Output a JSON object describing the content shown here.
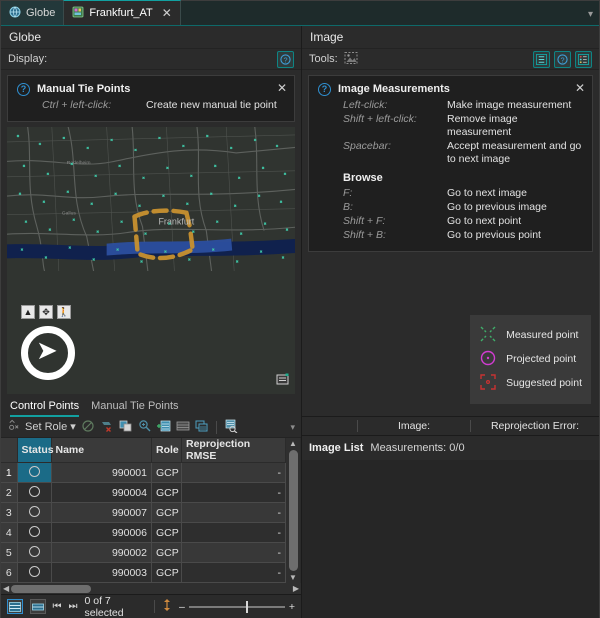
{
  "tabs": [
    {
      "label": "Globe",
      "icon": "globe-icon",
      "active": false,
      "closable": false
    },
    {
      "label": "Frankfurt_AT",
      "icon": "project-icon",
      "active": true,
      "closable": true
    }
  ],
  "tabbar": {
    "overflow_icon": "chevron-down-icon"
  },
  "globe_panel": {
    "title": "Globe",
    "display_label": "Display:",
    "help_icon": "question-circle-icon",
    "hint": {
      "icon": "question-circle-icon",
      "title": "Manual Tie Points",
      "close_icon": "close-icon",
      "rows": [
        {
          "key": "Ctrl + left-click:",
          "value": "Create new manual tie point"
        }
      ]
    },
    "map": {
      "place_label": "Frankfurt",
      "nav_buttons": [
        "home-icon",
        "pan-icon",
        "walk-icon"
      ],
      "compass_icon": "compass-needle-icon",
      "corner_icon": "layers-icon"
    }
  },
  "image_panel": {
    "title": "Image",
    "tools_label": "Tools:",
    "tools_icon": "image-measure-icon",
    "right_icons": [
      "list-detail-icon",
      "question-circle-icon",
      "list-bullet-icon"
    ],
    "hint": {
      "icon": "question-circle-icon",
      "title": "Image Measurements",
      "close_icon": "close-icon",
      "rows": [
        {
          "key": "Left-click:",
          "value": "Make image measurement"
        },
        {
          "key": "Shift + left-click:",
          "value": "Remove image measurement"
        },
        {
          "key": "Spacebar:",
          "value": "Accept measurement and go to next image"
        }
      ],
      "subtitle": "Browse",
      "browse_rows": [
        {
          "key": "F:",
          "value": "Go to next image"
        },
        {
          "key": "B:",
          "value": "Go to previous image"
        },
        {
          "key": "Shift + F:",
          "value": "Go to next point"
        },
        {
          "key": "Shift + B:",
          "value": "Go to previous point"
        }
      ]
    },
    "legend": [
      {
        "label": "Measured point",
        "icon": "measured-point-icon",
        "color": "#3fae6a"
      },
      {
        "label": "Projected point",
        "icon": "projected-point-icon",
        "color": "#d23cd2"
      },
      {
        "label": "Suggested point",
        "icon": "suggested-point-icon",
        "color": "#c83232"
      }
    ],
    "info_bar": {
      "image_label": "Image:",
      "reprojection_label": "Reprojection Error:"
    },
    "image_list": {
      "title": "Image List",
      "measurements": "Measurements: 0/0"
    }
  },
  "control_points": {
    "tabs": [
      {
        "label": "Control Points",
        "active": true
      },
      {
        "label": "Manual Tie Points",
        "active": false
      }
    ],
    "toolbar": {
      "set_role_label": "Set Role",
      "set_role_caret": "chevron-down-icon",
      "icons": [
        "set-role-icon",
        "disable-icon",
        "delete-point-icon",
        "copy-icon",
        "zoom-to-icon",
        "add-row-icon",
        "table-icon",
        "duplicate-icon",
        "find-icon"
      ],
      "overflow_icon": "chevron-down-icon"
    },
    "columns": [
      "Status",
      "Name",
      "Role",
      "Reprojection RMSE"
    ],
    "rows": [
      {
        "num": "1",
        "status": "circle-icon",
        "name": "990001",
        "role": "GCP",
        "rmse": "-",
        "selected": true
      },
      {
        "num": "2",
        "status": "circle-icon",
        "name": "990004",
        "role": "GCP",
        "rmse": "-",
        "selected": false
      },
      {
        "num": "3",
        "status": "circle-icon",
        "name": "990007",
        "role": "GCP",
        "rmse": "-",
        "selected": false
      },
      {
        "num": "4",
        "status": "circle-icon",
        "name": "990006",
        "role": "GCP",
        "rmse": "-",
        "selected": false
      },
      {
        "num": "5",
        "status": "circle-icon",
        "name": "990002",
        "role": "GCP",
        "rmse": "-",
        "selected": false
      },
      {
        "num": "6",
        "status": "circle-icon",
        "name": "990003",
        "role": "GCP",
        "rmse": "-",
        "selected": false
      }
    ]
  },
  "status_bar": {
    "view_table_icon": "table-view-icon",
    "view_list_icon": "list-view-icon",
    "first_icon": "first-record-icon",
    "next_icon": "next-record-icon",
    "selection_text": "0 of 7 selected",
    "updown_icon": "sort-arrows-icon",
    "zoom_out_label": "–",
    "zoom_in_label": "+",
    "zoom_percent": 60
  }
}
